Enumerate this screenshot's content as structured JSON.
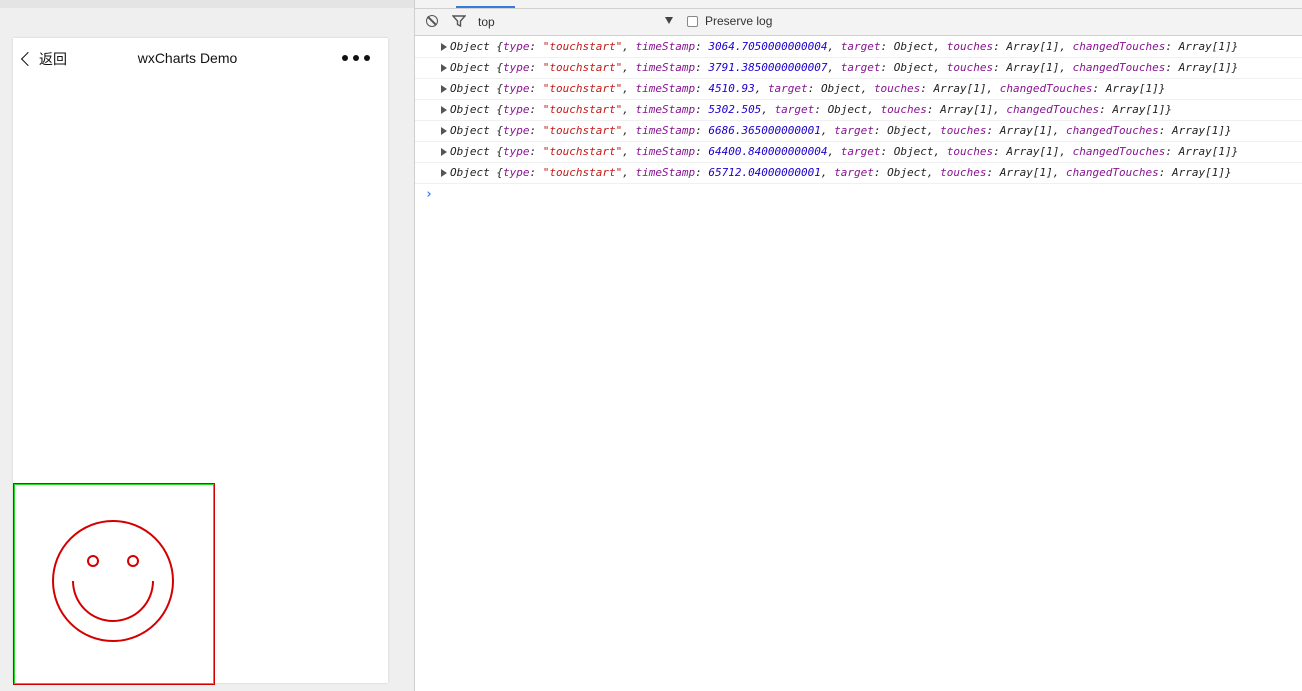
{
  "phone": {
    "back_label": "返回",
    "title": "wxCharts Demo",
    "more_icon": "more-dots-icon",
    "canvas": {
      "drawing": "smiley-face",
      "stroke_color": "#d40000",
      "border_color": "#22dd22"
    }
  },
  "console": {
    "toolbar": {
      "clear_icon": "clear-console-icon",
      "filter_icon": "filter-icon",
      "context": "top",
      "preserve_log_label": "Preserve log"
    },
    "logs": [
      {
        "prefix": "Object {",
        "k1": "type",
        "type": "\"touchstart\"",
        "k2": "timeStamp",
        "timestamp": "3064.7050000000004",
        "k3": "target",
        "target": "Object",
        "k4": "touches",
        "touches": "Array[1]",
        "k5": "changedTouches",
        "changed": "Array[1]",
        "suffix": "}"
      },
      {
        "prefix": "Object {",
        "k1": "type",
        "type": "\"touchstart\"",
        "k2": "timeStamp",
        "timestamp": "3791.3850000000007",
        "k3": "target",
        "target": "Object",
        "k4": "touches",
        "touches": "Array[1]",
        "k5": "changedTouches",
        "changed": "Array[1]",
        "suffix": "}"
      },
      {
        "prefix": "Object {",
        "k1": "type",
        "type": "\"touchstart\"",
        "k2": "timeStamp",
        "timestamp": "4510.93",
        "k3": "target",
        "target": "Object",
        "k4": "touches",
        "touches": "Array[1]",
        "k5": "changedTouches",
        "changed": "Array[1]",
        "suffix": "}"
      },
      {
        "prefix": "Object {",
        "k1": "type",
        "type": "\"touchstart\"",
        "k2": "timeStamp",
        "timestamp": "5302.505",
        "k3": "target",
        "target": "Object",
        "k4": "touches",
        "touches": "Array[1]",
        "k5": "changedTouches",
        "changed": "Array[1]",
        "suffix": "}"
      },
      {
        "prefix": "Object {",
        "k1": "type",
        "type": "\"touchstart\"",
        "k2": "timeStamp",
        "timestamp": "6686.365000000001",
        "k3": "target",
        "target": "Object",
        "k4": "touches",
        "touches": "Array[1]",
        "k5": "changedTouches",
        "changed": "Array[1]",
        "suffix": "}"
      },
      {
        "prefix": "Object {",
        "k1": "type",
        "type": "\"touchstart\"",
        "k2": "timeStamp",
        "timestamp": "64400.840000000004",
        "k3": "target",
        "target": "Object",
        "k4": "touches",
        "touches": "Array[1]",
        "k5": "changedTouches",
        "changed": "Array[1]",
        "suffix": "}"
      },
      {
        "prefix": "Object {",
        "k1": "type",
        "type": "\"touchstart\"",
        "k2": "timeStamp",
        "timestamp": "65712.04000000001",
        "k3": "target",
        "target": "Object",
        "k4": "touches",
        "touches": "Array[1]",
        "k5": "changedTouches",
        "changed": "Array[1]",
        "suffix": "}"
      }
    ],
    "prompt": "›"
  },
  "colors": {
    "key": "#881391",
    "string": "#c41a16",
    "number": "#1c00cf",
    "accent": "#3879d9"
  }
}
